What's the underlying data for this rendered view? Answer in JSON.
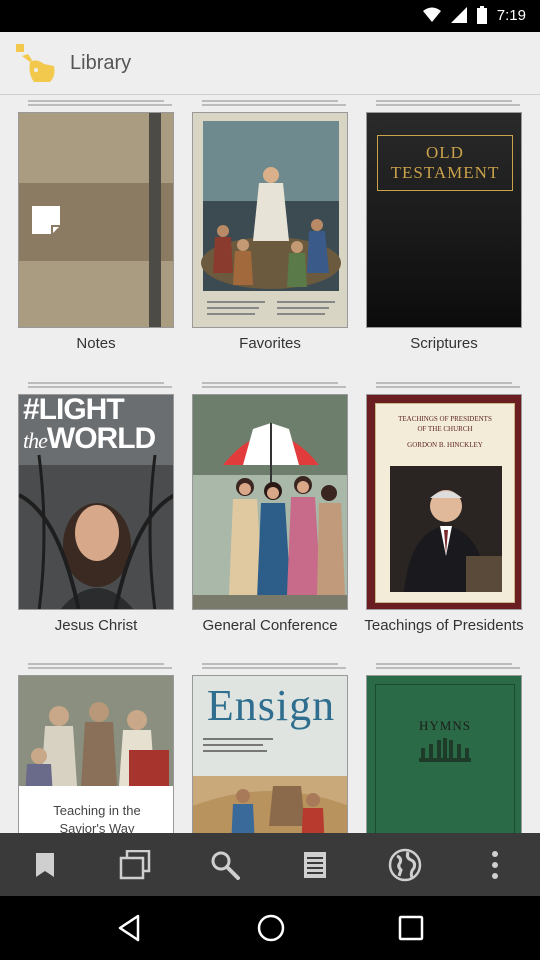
{
  "status_bar": {
    "time": "7:19"
  },
  "app_bar": {
    "title": "Library"
  },
  "covers": {
    "old_testament": [
      "OLD",
      "TESTAMENT"
    ],
    "light_the_world": [
      "#LIGHT",
      "the",
      "WORLD"
    ],
    "teachings": [
      "TEACHINGS OF PRESIDENTS",
      "OF THE CHURCH",
      "GORDON B. HINCKLEY"
    ],
    "teaching_savior": [
      "Teaching in the",
      "Savior's Way"
    ],
    "ensign": "Ensign",
    "hymns": "HYMNS"
  },
  "books": [
    {
      "label": "Notes"
    },
    {
      "label": "Favorites"
    },
    {
      "label": "Scriptures"
    },
    {
      "label": "Jesus Christ"
    },
    {
      "label": "General Conference"
    },
    {
      "label": "Teachings of Presidents"
    },
    {
      "label": ""
    },
    {
      "label": ""
    },
    {
      "label": ""
    }
  ],
  "nav_icons": [
    "bookmark-icon",
    "windows-icon",
    "search-icon",
    "list-icon",
    "globe-icon",
    "more-icon"
  ],
  "colors": {
    "app_bar_bg": "#eeeeee",
    "nav_bar_bg": "#3a3a3a",
    "logo_yellow": "#f2c94c"
  }
}
